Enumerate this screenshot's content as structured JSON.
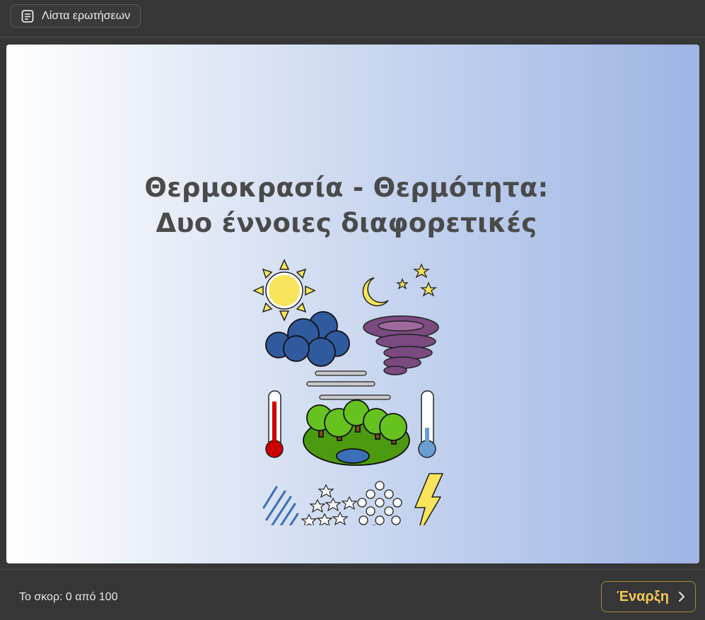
{
  "header": {
    "question_list_label": "Λίστα ερωτήσεων",
    "question_list_icon": "document-list-icon"
  },
  "slide": {
    "title_line1": "Θερμοκρασία - Θερμότητα:",
    "title_line2": "Δυο έννοιες διαφορετικές",
    "illustration": "weather-illustration"
  },
  "footer": {
    "score_text": "Το σκορ: 0 από 100",
    "start_label": "Έναρξη",
    "start_icon": "chevron-right-icon"
  },
  "colors": {
    "background": "#363636",
    "accent": "#f3c658",
    "title": "#4a4a4a"
  }
}
